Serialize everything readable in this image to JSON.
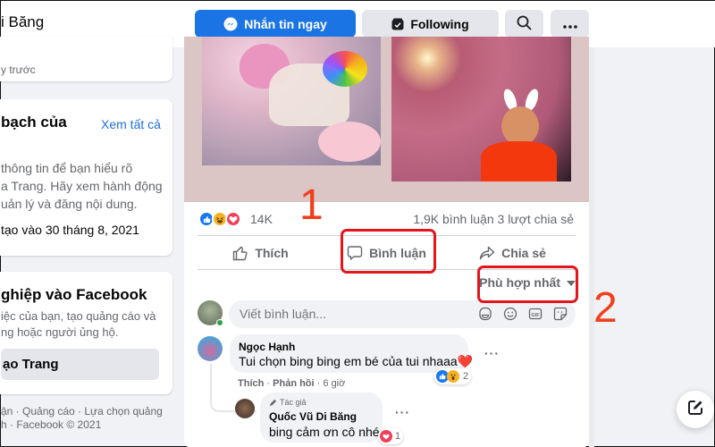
{
  "header": {
    "page_name": "i Băng",
    "message_button": "Nhắn tin ngay",
    "following_button": "Following",
    "search_icon": "search-icon",
    "more_icon": "more-icon"
  },
  "left_column": {
    "top_card_time": "y trước",
    "transparency": {
      "title": "bạch của",
      "see_all": "Xem tất cả",
      "description": [
        "thông tin để bạn hiểu rõ",
        "a Trang. Hãy xem hành động",
        "uản lý và đăng nội dung."
      ],
      "created": "tạo vào 30 tháng 8, 2021"
    },
    "business": {
      "title": "ghiệp vào Facebook",
      "description": [
        "iệc của bạn, tạo quảng cáo và",
        "ng hoặc người ủng hộ."
      ],
      "create_button": "ạo Trang"
    },
    "footer": [
      "ận · Quảng cáo · Lựa chọn quảng",
      "h · Facebook © 2021"
    ]
  },
  "post": {
    "reaction_icons": [
      "like-icon",
      "haha-icon",
      "love-icon"
    ],
    "reaction_count": "14K",
    "stats": "1,9K bình luận  3 lượt chia sẻ",
    "actions": {
      "like": "Thích",
      "comment": "Bình luận",
      "share": "Chia sẻ"
    },
    "sort_label": "Phù hợp nhất",
    "composer_placeholder": "Viết bình luận...",
    "composer_tools": [
      "avatar-sticker-icon",
      "emoji-icon",
      "gif-icon",
      "sticker-icon"
    ]
  },
  "comments": [
    {
      "author": "Ngọc Hạnh",
      "text": "Tui chọn bing bing em bé của tui nhaaa❤️",
      "reactions": [
        "like",
        "wow"
      ],
      "reaction_count": "2",
      "like_label": "Thích",
      "reply_label": "Phản hồi",
      "time": "6 giờ",
      "replies": [
        {
          "badge": "Tác giả",
          "author": "Quốc Vũ Di Băng",
          "text": "bing cảm ơn cô nhé",
          "reactions": [
            "love"
          ],
          "reaction_count": "1"
        }
      ]
    }
  ],
  "annotations": {
    "step_1": "1",
    "step_2": "2",
    "color": "#f0401c"
  },
  "colors": {
    "primary": "#1b74e4",
    "link": "#216fdb",
    "annotation_box": "#e4161c"
  }
}
